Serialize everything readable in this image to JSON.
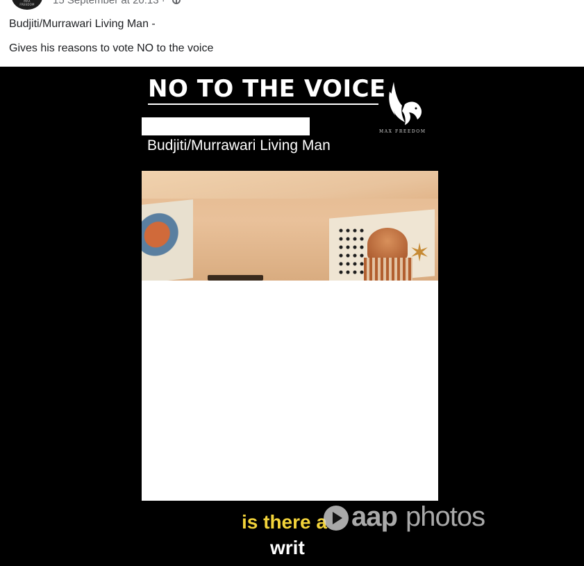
{
  "post": {
    "avatar_text": "MAX FREEDOM",
    "timestamp": "15 September at 20:13 ·",
    "text_line1": "Budjiti/Murrawari Living Man -",
    "text_line2": "Gives his reasons to vote NO to the voice"
  },
  "video": {
    "title": "NO TO THE VOICE",
    "brand": "MAX FREEDOM",
    "subtitle": "Budjiti/Murrawari Living Man",
    "caption_line1": "is there a",
    "caption_line2": "writ"
  },
  "watermark": {
    "part1": "aap",
    "part2": "photos"
  },
  "colors": {
    "caption_yellow": "#f2d33a",
    "video_background": "#000000",
    "secondary_text": "#65676b"
  },
  "icons": [
    "globe-icon",
    "hawk-logo",
    "play-icon"
  ]
}
